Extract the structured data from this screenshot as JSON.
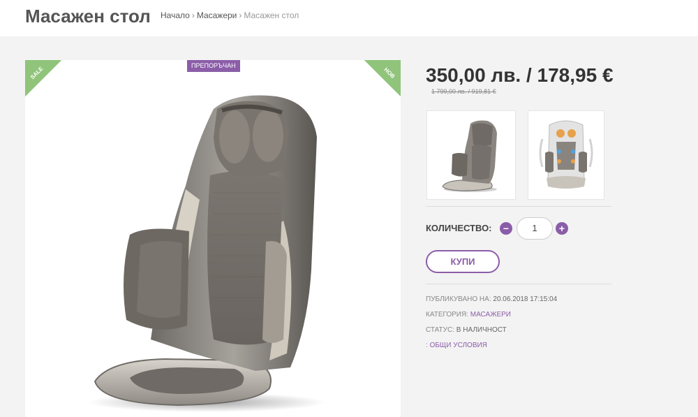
{
  "header": {
    "title": "Масажен стол",
    "breadcrumb": [
      {
        "label": "Начало"
      },
      {
        "label": "Масажери"
      },
      {
        "label": "Масажен стол"
      }
    ],
    "separator": "›"
  },
  "product": {
    "ribbon_left": "SALE",
    "ribbon_right": "НОВ",
    "badge": "ПРЕПОРЪЧАН",
    "price": "350,00 лв. / 178,95 €",
    "old_price": "1 799,00 лв. / 919,81 €"
  },
  "quantity": {
    "label": "КОЛИЧЕСТВО:",
    "minus": "−",
    "plus": "+",
    "value": "1"
  },
  "buy_label": "КУПИ",
  "meta": {
    "published_label": "ПУБЛИКУВАНО НА:",
    "published_value": "20.06.2018 17:15:04",
    "category_label": "КАТЕГОРИЯ:",
    "category_value": "МАСАЖЕРИ",
    "status_label": "СТАТУС:",
    "status_value": "В НАЛИЧНОСТ",
    "terms_prefix": ":",
    "terms_link": "ОБЩИ УСЛОВИЯ"
  },
  "colors": {
    "accent": "#8b5da8",
    "ribbon": "#8fc47a"
  }
}
